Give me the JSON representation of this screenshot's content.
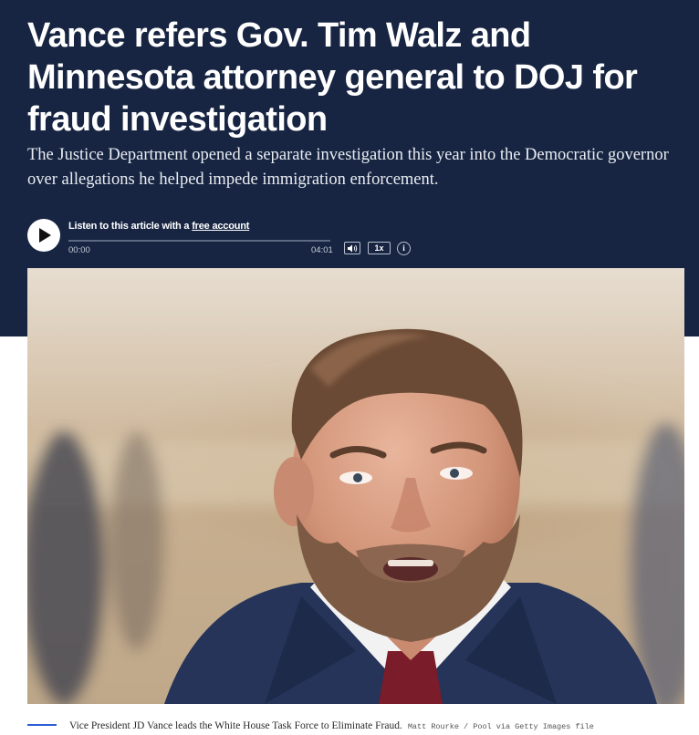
{
  "article": {
    "headline": "Vance refers Gov. Tim Walz and Minnesota attorney general to DOJ for fraud investigation",
    "dek": "The Justice Department opened a separate investigation this year into the Democratic governor over allegations he helped impede immigration enforcement."
  },
  "audio_player": {
    "listen_prefix": "Listen to this article with a ",
    "listen_link": "free account",
    "time_current": "00:00",
    "time_total": "04:01",
    "progress_fraction": 0,
    "speed_label": "1x",
    "info_label": "i",
    "play_icon": "play-icon",
    "volume_icon": "volume-icon"
  },
  "photo": {
    "caption": "Vice President JD Vance leads the White House Task Force to Eliminate Fraud.",
    "credit": "Matt Rourke / Pool via Getty Images file"
  },
  "colors": {
    "hero_background": "#172542",
    "caption_rule": "#2f5fd6"
  }
}
